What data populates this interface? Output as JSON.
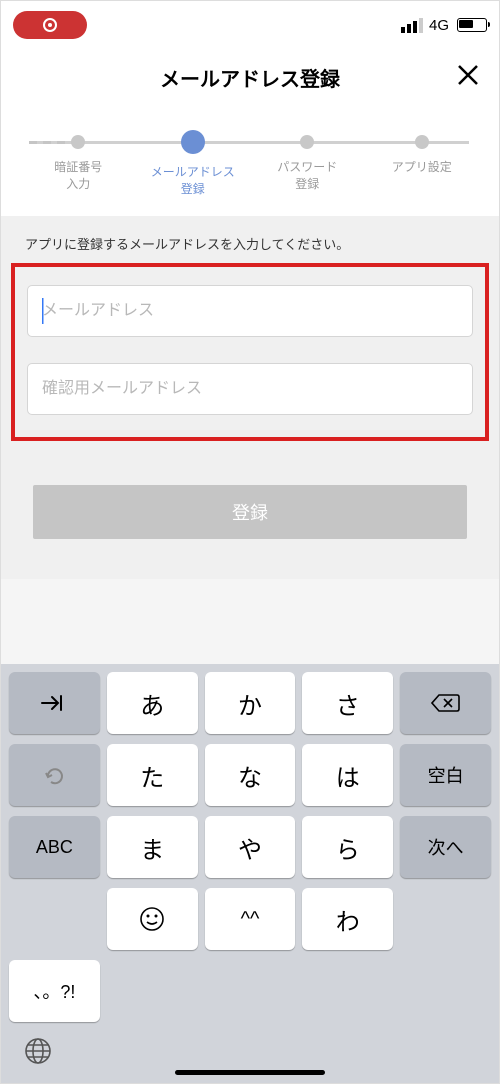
{
  "statusBar": {
    "networkLabel": "4G"
  },
  "header": {
    "title": "メールアドレス登録"
  },
  "stepper": {
    "steps": [
      {
        "label": "暗証番号\n入力"
      },
      {
        "label": "メールアドレス\n登録"
      },
      {
        "label": "パスワード\n登録"
      },
      {
        "label": "アプリ設定"
      }
    ]
  },
  "form": {
    "instruction": "アプリに登録するメールアドレスを入力してください。",
    "emailPlaceholder": "メールアドレス",
    "confirmPlaceholder": "確認用メールアドレス",
    "submitLabel": "登録"
  },
  "keyboard": {
    "rows": [
      [
        "あ",
        "か",
        "さ"
      ],
      [
        "た",
        "な",
        "は"
      ],
      [
        "ま",
        "や",
        "ら"
      ],
      [
        "^^",
        "わ",
        "、。?!"
      ]
    ],
    "funcKeys": {
      "space": "空白",
      "abc": "ABC",
      "next": "次へ"
    }
  }
}
